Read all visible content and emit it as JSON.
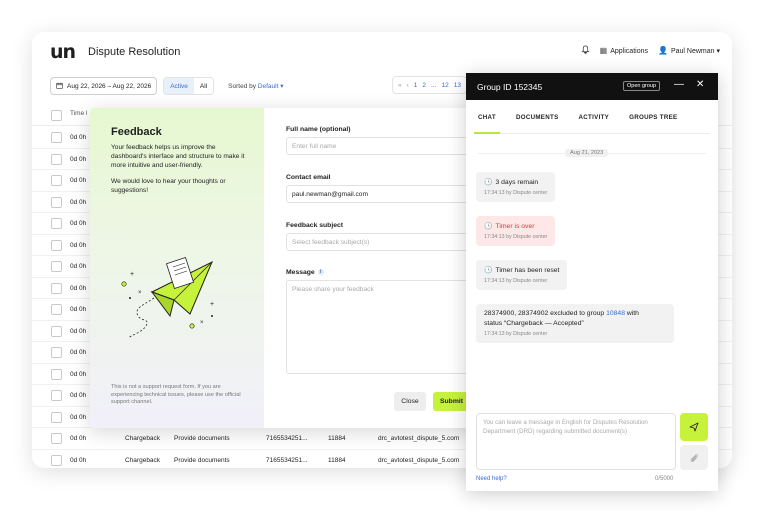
{
  "app": {
    "logo": "un",
    "title": "Dispute Resolution"
  },
  "topbar": {
    "notification_icon": "bell-icon",
    "applications": "Applications",
    "user": "Paul Newman",
    "user_chevron": "▾"
  },
  "filters": {
    "date_range": "Aug 22, 2026 – Aug 22, 2026",
    "status_active": "Active",
    "status_all": "All",
    "sorted_label": "Sorted by",
    "sorted_value": "Default"
  },
  "pagination": {
    "first": "«",
    "prev": "‹",
    "p1": "1",
    "p2": "2",
    "ellipsis": "...",
    "p12": "12",
    "p13": "13"
  },
  "table": {
    "header_time": "Time l",
    "rows": [
      {
        "time": "0d 0h",
        "type": "",
        "action": "",
        "id": "",
        "amount": "",
        "file": ""
      },
      {
        "time": "0d 0h",
        "type": "",
        "action": "",
        "id": "",
        "amount": "",
        "file": ""
      },
      {
        "time": "0d 0h",
        "type": "",
        "action": "",
        "id": "",
        "amount": "",
        "file": ""
      },
      {
        "time": "0d 0h",
        "type": "",
        "action": "",
        "id": "",
        "amount": "",
        "file": ""
      },
      {
        "time": "0d 0h",
        "type": "",
        "action": "",
        "id": "",
        "amount": "",
        "file": ""
      },
      {
        "time": "0d 0h",
        "type": "",
        "action": "",
        "id": "",
        "amount": "",
        "file": ""
      },
      {
        "time": "0d 0h",
        "type": "",
        "action": "",
        "id": "",
        "amount": "",
        "file": ""
      },
      {
        "time": "0d 0h",
        "type": "",
        "action": "",
        "id": "",
        "amount": "",
        "file": ""
      },
      {
        "time": "0d 0h",
        "type": "",
        "action": "",
        "id": "",
        "amount": "",
        "file": ""
      },
      {
        "time": "0d 0h",
        "type": "",
        "action": "",
        "id": "",
        "amount": "",
        "file": ""
      },
      {
        "time": "0d 0h",
        "type": "",
        "action": "",
        "id": "",
        "amount": "",
        "file": ""
      },
      {
        "time": "0d 0h",
        "type": "",
        "action": "",
        "id": "",
        "amount": "",
        "file": ""
      },
      {
        "time": "0d 0h",
        "type": "",
        "action": "",
        "id": "",
        "amount": "",
        "file": ""
      },
      {
        "time": "0d 0h",
        "type": "",
        "action": "",
        "id": "",
        "amount": "",
        "file": ""
      },
      {
        "time": "0d 0h",
        "type": "Chargeback",
        "action": "Provide documents",
        "id": "7165534251...",
        "amount": "11884",
        "file": "drc_avtotest_dispute_5.com"
      },
      {
        "time": "0d 0h",
        "type": "Chargeback",
        "action": "Provide documents",
        "id": "7165534251...",
        "amount": "11884",
        "file": "drc_avtotest_dispute_5.com"
      }
    ]
  },
  "feedback": {
    "title": "Feedback",
    "desc1": "Your feedback helps us improve the dashboard's interface and structure to make it more intuitive and user-friendly.",
    "desc2": "We would love to hear your thoughts or suggestions!",
    "note": "This is not a support request form. If you are experiencing technical issues, please use the official support channel.",
    "illustration": "paper-plane-illustration",
    "full_name_label": "Full name (optional)",
    "full_name_placeholder": "Enter full name",
    "email_label": "Contact email",
    "email_value": "paul.newman@gmail.com",
    "subject_label": "Feedback subject",
    "subject_placeholder": "Select feedback subject(s)",
    "message_label": "Message",
    "message_placeholder": "Please share your feedback",
    "close": "Close",
    "submit": "Submit"
  },
  "chat": {
    "title": "Group ID 152345",
    "open_group": "Open group",
    "minimize": "—",
    "close": "✕",
    "tabs": [
      "CHAT",
      "DOCUMENTS",
      "ACTIVITY",
      "GROUPS TREE"
    ],
    "date": "Aug 21, 2023",
    "messages": [
      {
        "text": "3 days remain",
        "meta": "17:34:13 by Dispute center",
        "icon": "clock-icon"
      },
      {
        "text": "Timer is over",
        "meta": "17:34:13 by Dispute center",
        "icon": "clock-icon",
        "accent": "#d33e3e"
      },
      {
        "text": "Timer has been reset",
        "meta": "17:34:13 by Dispute center",
        "icon": "clock-icon"
      }
    ],
    "exclusion": {
      "pre": "28374900, 28374902 excluded to group ",
      "link": "10848",
      "post": " with",
      "line2": "status “Chargeback — Accepted”",
      "meta": "17:34:13 by Dispute center"
    },
    "input_placeholder": "You can leave a message in English for Disputes Resolution Department (DRD) regarding submitted document(s)",
    "need_help": "Need help?",
    "char_count": "0/5000"
  },
  "colors": {
    "accent_lime": "#c6f23b",
    "link_blue": "#3a6cd4",
    "alert_red": "#d33e3e",
    "chat_header": "#111111"
  }
}
